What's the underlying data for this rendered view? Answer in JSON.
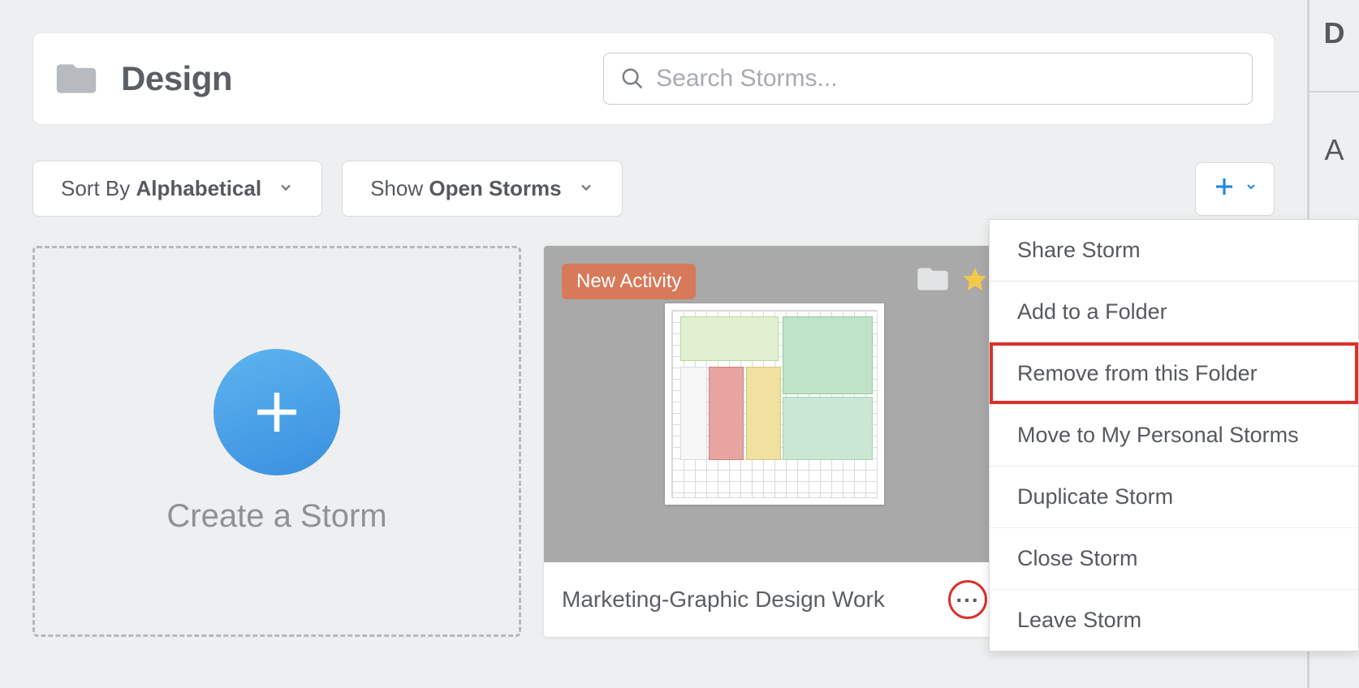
{
  "header": {
    "title": "Design",
    "search_placeholder": "Search Storms..."
  },
  "controls": {
    "sort_prefix": "Sort By ",
    "sort_value": "Alphabetical",
    "show_prefix": "Show ",
    "show_value": "Open Storms"
  },
  "create_card": {
    "label": "Create a Storm"
  },
  "storm_card": {
    "badge": "New Activity",
    "title": "Marketing-Graphic Design Work"
  },
  "menu": {
    "items": [
      {
        "label": "Share Storm",
        "group_start": false,
        "highlight": false
      },
      {
        "label": "Add to a Folder",
        "group_start": true,
        "highlight": false
      },
      {
        "label": "Remove from this Folder",
        "group_start": false,
        "highlight": true
      },
      {
        "label": "Move to My Personal Storms",
        "group_start": false,
        "highlight": false
      },
      {
        "label": "Duplicate Storm",
        "group_start": true,
        "highlight": false
      },
      {
        "label": "Close Storm",
        "group_start": false,
        "highlight": false
      },
      {
        "label": "Leave Storm",
        "group_start": false,
        "highlight": false
      }
    ]
  },
  "right_panel": {
    "letter1": "D",
    "letter2": "A"
  }
}
